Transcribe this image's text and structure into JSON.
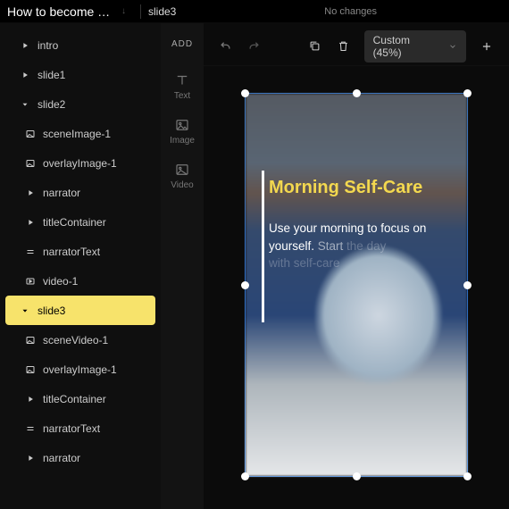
{
  "header": {
    "project_title": "How to become p…",
    "separator": "↓",
    "current": "slide3",
    "changes": "No changes"
  },
  "tree": {
    "items": [
      {
        "icon": "play",
        "label": "intro",
        "indent": 1
      },
      {
        "icon": "play",
        "label": "slide1",
        "indent": 1
      },
      {
        "icon": "caret-down",
        "label": "slide2",
        "indent": 1
      },
      {
        "icon": "image",
        "label": "sceneImage-1",
        "indent": 2
      },
      {
        "icon": "image",
        "label": "overlayImage-1",
        "indent": 2
      },
      {
        "icon": "play",
        "label": "narrator",
        "indent": 2
      },
      {
        "icon": "play",
        "label": "titleContainer",
        "indent": 2
      },
      {
        "icon": "text",
        "label": "narratorText",
        "indent": 2
      },
      {
        "icon": "video",
        "label": "video-1",
        "indent": 2
      },
      {
        "icon": "caret-down",
        "label": "slide3",
        "indent": 1,
        "selected": true
      },
      {
        "icon": "image",
        "label": "sceneVideo-1",
        "indent": 2
      },
      {
        "icon": "image",
        "label": "overlayImage-1",
        "indent": 2
      },
      {
        "icon": "play",
        "label": "titleContainer",
        "indent": 2
      },
      {
        "icon": "text",
        "label": "narratorText",
        "indent": 2
      },
      {
        "icon": "play",
        "label": "narrator",
        "indent": 2
      }
    ]
  },
  "add": {
    "header": "ADD",
    "text": "Text",
    "image": "Image",
    "video": "Video"
  },
  "toolbar": {
    "zoom": "Custom (45%)"
  },
  "slide": {
    "title": "Morning Self-Care",
    "body_plain": "Use your morning to focus on yourself. ",
    "body_fade1": "Start ",
    "body_fade2": "the day",
    "body_line3": "with self-care"
  }
}
